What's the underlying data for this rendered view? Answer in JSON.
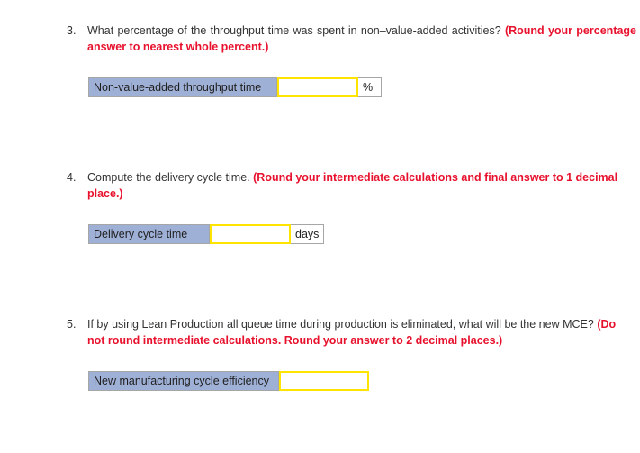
{
  "page": {
    "background_color": "#ffffff",
    "text_color": "#333333",
    "note_color": "#e8112d",
    "label_fill_color": "#9fb0d6",
    "input_border_color": "#ffe400"
  },
  "questions": [
    {
      "number": "3.",
      "text": "What percentage of the throughput time was spent in non–value-added activities?",
      "note": "(Round your percentage answer to nearest whole percent.)",
      "answer": {
        "label": "Non-value-added throughput time",
        "value": "",
        "placeholder": "",
        "unit": "%"
      }
    },
    {
      "number": "4.",
      "text": "Compute the delivery cycle time.",
      "note": "(Round your intermediate calculations and final answer to 1 decimal place.)",
      "answer": {
        "label": "Delivery cycle time",
        "value": "",
        "placeholder": "",
        "unit": "days"
      }
    },
    {
      "number": "5.",
      "text": "If by using Lean Production all queue time during production is eliminated, what will be the new MCE?",
      "note": "(Do not round intermediate calculations. Round your answer to 2 decimal places.)",
      "answer": {
        "label": "New manufacturing cycle efficiency",
        "value": "",
        "placeholder": "",
        "unit": ""
      }
    }
  ]
}
